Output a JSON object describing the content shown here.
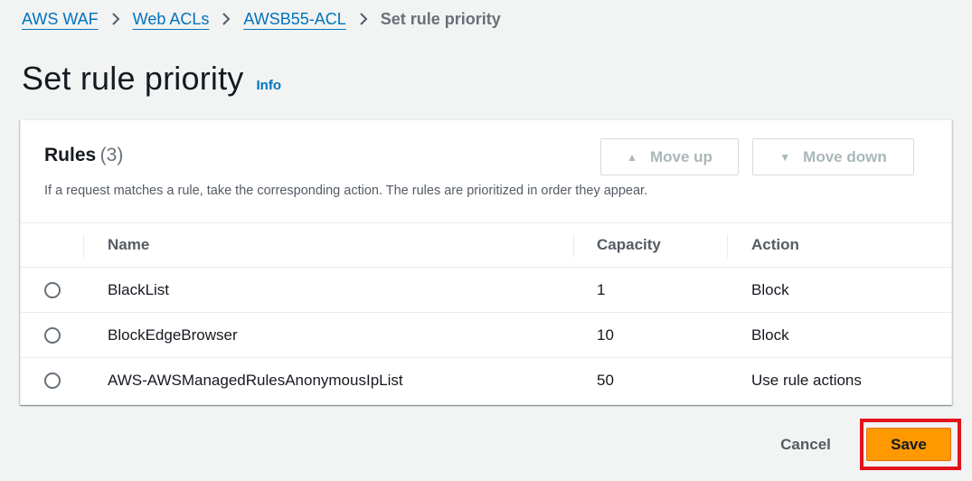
{
  "breadcrumb": {
    "items": [
      "AWS WAF",
      "Web ACLs",
      "AWSB55-ACL"
    ],
    "current": "Set rule priority"
  },
  "page": {
    "title": "Set rule priority",
    "info_label": "Info"
  },
  "rules_panel": {
    "title": "Rules",
    "count": "(3)",
    "description": "If a request matches a rule, take the corresponding action. The rules are prioritized in order they appear.",
    "move_up_label": "Move up",
    "move_down_label": "Move down",
    "columns": [
      "Name",
      "Capacity",
      "Action"
    ],
    "rows": [
      {
        "name": "BlackList",
        "capacity": "1",
        "action": "Block"
      },
      {
        "name": "BlockEdgeBrowser",
        "capacity": "10",
        "action": "Block"
      },
      {
        "name": "AWS-AWSManagedRulesAnonymousIpList",
        "capacity": "50",
        "action": "Use rule actions"
      }
    ]
  },
  "footer": {
    "cancel_label": "Cancel",
    "save_label": "Save"
  },
  "colors": {
    "link": "#0073bb",
    "primary": "#ff9900",
    "highlight": "#e3131c"
  },
  "icons": {
    "separator": "chevron-right-icon",
    "move_up": "triangle-up-icon",
    "move_down": "triangle-down-icon"
  }
}
